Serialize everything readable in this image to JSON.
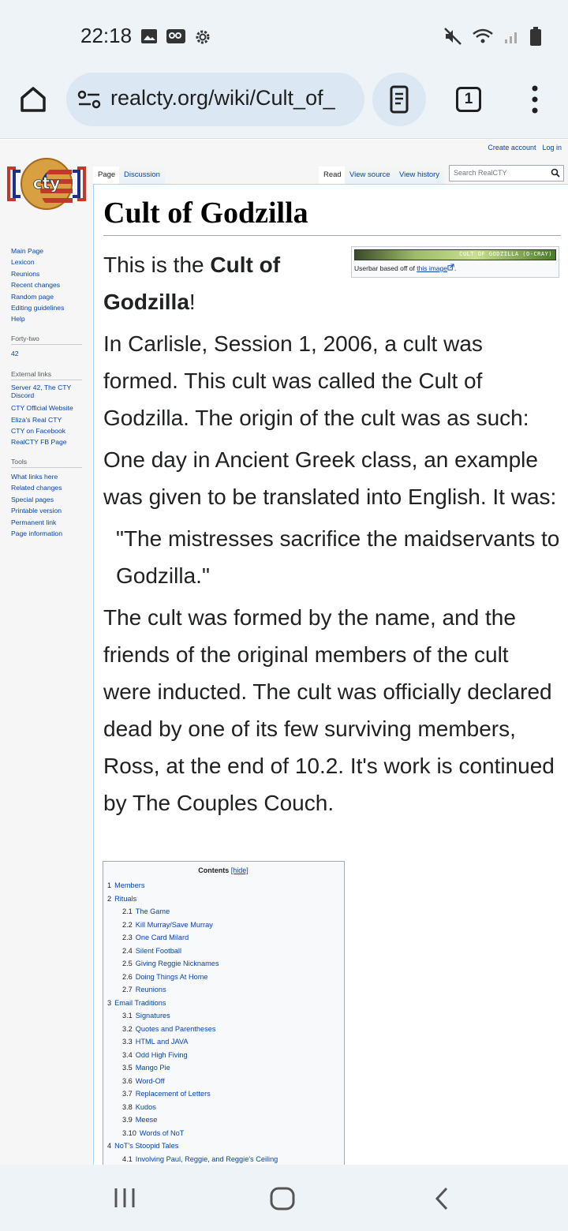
{
  "status": {
    "time": "22:18"
  },
  "browser": {
    "url": "realcty.org/wiki/Cult_of_",
    "tab_count": "1"
  },
  "personal": {
    "create_account": "Create account",
    "log_in": "Log in"
  },
  "tabs": {
    "page": "Page",
    "discussion": "Discussion",
    "read": "Read",
    "view_source": "View source",
    "view_history": "View history"
  },
  "search": {
    "placeholder": "Search RealCTY"
  },
  "sidebar": {
    "nav": [
      "Main Page",
      "Lexicon",
      "Reunions",
      "Recent changes",
      "Random page",
      "Editing guidelines",
      "Help"
    ],
    "forty_two_head": "Forty-two",
    "forty_two": [
      "42"
    ],
    "external_head": "External links",
    "external": [
      "Server 42, The CTY Discord",
      "CTY Official Website",
      "Eliza's Real CTY",
      "CTY on Facebook",
      "RealCTY FB Page"
    ],
    "tools_head": "Tools",
    "tools": [
      "What links here",
      "Related changes",
      "Special pages",
      "Printable version",
      "Permanent link",
      "Page information"
    ]
  },
  "article": {
    "title": "Cult of Godzilla",
    "userbar_banner": "CULT OF GODZILLA (O-CRAY)",
    "userbar_caption": "Userbar based off of",
    "userbar_link": "this image",
    "intro_pre": "This is the ",
    "intro_bold": "Cult of Godzilla",
    "intro_post": "!",
    "p1": "In Carlisle, Session 1, 2006, a cult was formed. This cult was called the Cult of Godzilla. The origin of the cult was as such:",
    "p2": "One day in Ancient Greek class, an example was given to be translated into English. It was:",
    "quote": "\"The mistresses sacrifice the maidservants to Godzilla.\"",
    "p3": "The cult was formed by the name, and the friends of the original members of the cult were inducted. The cult was officially declared dead by one of its few surviving members, Ross, at the end of 10.2. It's work is continued by The Couples Couch."
  },
  "toc": {
    "title": "Contents",
    "hide": "[hide]",
    "items": [
      {
        "num": "1",
        "label": "Members",
        "level": 1
      },
      {
        "num": "2",
        "label": "Rituals",
        "level": 1
      },
      {
        "num": "2.1",
        "label": "The Game",
        "level": 2
      },
      {
        "num": "2.2",
        "label": "Kill Murray/Save Murray",
        "level": 2
      },
      {
        "num": "2.3",
        "label": "One Card Milard",
        "level": 2
      },
      {
        "num": "2.4",
        "label": "Silent Football",
        "level": 2
      },
      {
        "num": "2.5",
        "label": "Giving Reggie Nicknames",
        "level": 2
      },
      {
        "num": "2.6",
        "label": "Doing Things At Home",
        "level": 2
      },
      {
        "num": "2.7",
        "label": "Reunions",
        "level": 2
      },
      {
        "num": "3",
        "label": "Email Traditions",
        "level": 1
      },
      {
        "num": "3.1",
        "label": "Signatures",
        "level": 2
      },
      {
        "num": "3.2",
        "label": "Quotes and Parentheses",
        "level": 2
      },
      {
        "num": "3.3",
        "label": "HTML and JAVA",
        "level": 2
      },
      {
        "num": "3.4",
        "label": "Odd High Fiving",
        "level": 2
      },
      {
        "num": "3.5",
        "label": "Mango Pie",
        "level": 2
      },
      {
        "num": "3.6",
        "label": "Word-Off",
        "level": 2
      },
      {
        "num": "3.7",
        "label": "Replacement of Letters",
        "level": 2
      },
      {
        "num": "3.8",
        "label": "Kudos",
        "level": 2
      },
      {
        "num": "3.9",
        "label": "Meese",
        "level": 2
      },
      {
        "num": "3.10",
        "label": "Words of NoT",
        "level": 2
      },
      {
        "num": "4",
        "label": "NoT's Stoopid Tales",
        "level": 1
      },
      {
        "num": "4.1",
        "label": "Involving Paul, Reggie, and Reggie's Ceiling",
        "level": 2
      }
    ]
  },
  "icons": {
    "home": "home-icon",
    "tune": "tune-icon",
    "reader": "reader-mode-icon",
    "menu": "more-vert-icon",
    "mute": "mute-icon",
    "wifi": "wifi-icon",
    "battery": "battery-icon"
  },
  "colors": {
    "link": "#0645ad",
    "chrome_bg": "#eef3f8",
    "url_bg": "#dbe7f3"
  }
}
